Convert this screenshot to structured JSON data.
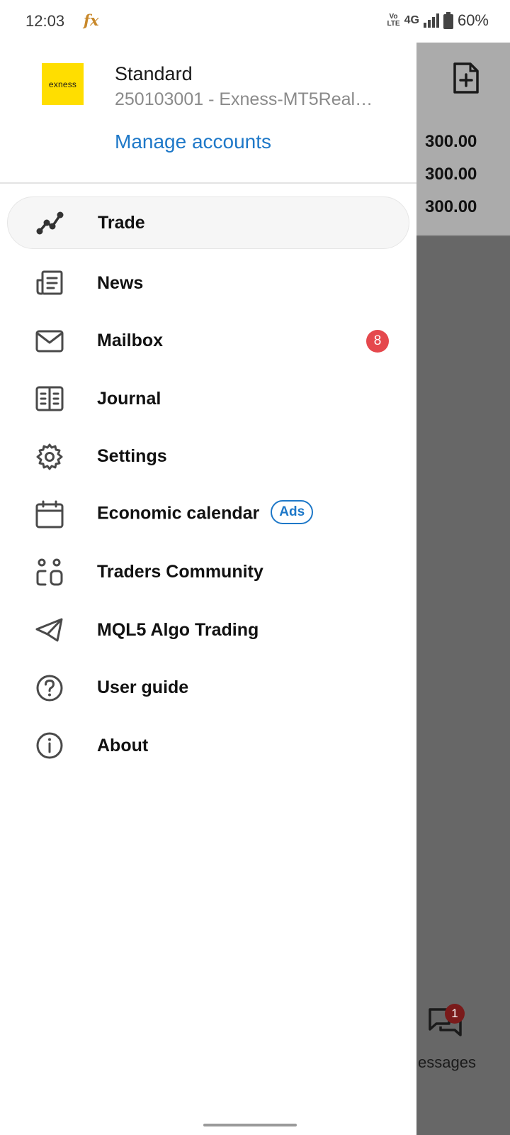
{
  "status_bar": {
    "time": "12:03",
    "app_glyph": "fx",
    "volte_top": "Vo",
    "volte_bottom": "LTE",
    "network": "4G",
    "battery": "60%"
  },
  "drawer": {
    "brand_logo_text": "exness",
    "account_name": "Standard",
    "account_number": "250103001 - Exness-MT5Real…",
    "manage_accounts_label": "Manage accounts",
    "menu": [
      {
        "label": "Trade",
        "icon": "trade-chart-icon"
      },
      {
        "label": "News",
        "icon": "news-icon"
      },
      {
        "label": "Mailbox",
        "icon": "mail-icon",
        "badge": "8"
      },
      {
        "label": "Journal",
        "icon": "journal-icon"
      },
      {
        "label": "Settings",
        "icon": "gear-icon"
      },
      {
        "label": "Economic calendar",
        "icon": "calendar-icon",
        "tag": "Ads"
      },
      {
        "label": "Traders Community",
        "icon": "community-icon"
      },
      {
        "label": "MQL5 Algo Trading",
        "icon": "send-icon"
      },
      {
        "label": "User guide",
        "icon": "help-icon"
      },
      {
        "label": "About",
        "icon": "info-icon"
      }
    ]
  },
  "background_app": {
    "values": [
      "300.00",
      "300.00",
      "300.00"
    ],
    "messages_badge": "1",
    "messages_label": "essages"
  },
  "colors": {
    "accent": "#1e78c8",
    "badge_red": "#e5484d",
    "brand_yellow": "#ffde00",
    "scrim": "#676767"
  }
}
